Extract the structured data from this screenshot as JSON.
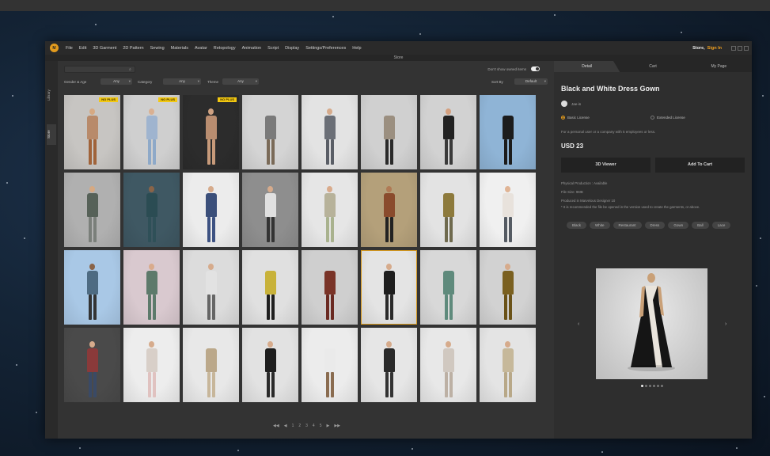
{
  "menu": {
    "logo": "M",
    "items": [
      "File",
      "Edit",
      "3D Garment",
      "2D Pattern",
      "Sewing",
      "Materials",
      "Avatar",
      "Retopology",
      "Animation",
      "Script",
      "Display",
      "Settings/Preferences",
      "Help"
    ],
    "store": "Store,",
    "sign_in": "Sign In"
  },
  "window_title": "Store",
  "rail": {
    "tab1": "Library",
    "tab2": "Store"
  },
  "catalog": {
    "toggle_label": "Don't show owned items",
    "filters": {
      "gender_label": "Gender & Age",
      "gender_value": "Any",
      "category_label": "Category",
      "category_value": "Any",
      "theme_label": "Theme",
      "theme_value": "Any",
      "sort_label": "Sort By",
      "sort_value": "Default"
    },
    "badge_text": "NO PLUS",
    "pager": [
      "◀◀",
      "◀",
      "1",
      "2",
      "3",
      "4",
      "5",
      "▶",
      "▶▶"
    ]
  },
  "tiles": [
    {
      "bg": "#c7c5c2",
      "skin": "#d6a982",
      "top": "#b88a6a",
      "bottom": "#a0633a",
      "badge": true
    },
    {
      "bg": "#cfcfcf",
      "skin": "#d9b092",
      "top": "#9fb4cf",
      "bottom": "#8ea9c8",
      "badge": true
    },
    {
      "bg": "#2c2c2c",
      "skin": "#cfa282",
      "top": "#b98d70",
      "bottom": "#c79a7a",
      "badge": true
    },
    {
      "bg": "#d4d4d4",
      "skin": "#d4d4d4",
      "top": "#7a7a7a",
      "bottom": "#7a6a58",
      "badge": false
    },
    {
      "bg": "#e3e3e3",
      "skin": "#d6ab8c",
      "top": "#6b6f77",
      "bottom": "#5a5e66",
      "badge": false
    },
    {
      "bg": "#d0d0d0",
      "skin": "#d0d0d0",
      "top": "#9b8f80",
      "bottom": "#2a2a2a",
      "badge": false
    },
    {
      "bg": "#d2d2d2",
      "skin": "#d4a07f",
      "top": "#222222",
      "bottom": "#3a3a3a",
      "badge": false
    },
    {
      "bg": "#8fb4d6",
      "skin": "#8fb4d6",
      "top": "#1c1c1c",
      "bottom": "#1c1c1c",
      "badge": false
    },
    {
      "bg": "#b0b0b0",
      "skin": "#d6a982",
      "top": "#566158",
      "bottom": "#7a7f7a",
      "badge": false
    },
    {
      "bg": "#3f5863",
      "skin": "#8a6448",
      "top": "#2b4c53",
      "bottom": "#2f5058",
      "badge": false
    },
    {
      "bg": "#ececec",
      "skin": "#d6ab8c",
      "top": "#3b4f7a",
      "bottom": "#3d5282",
      "badge": false
    },
    {
      "bg": "#8e8e8e",
      "skin": "#d6ab8c",
      "top": "#e0e0e0",
      "bottom": "#333333",
      "badge": false
    },
    {
      "bg": "#e6e6e6",
      "skin": "#d9ab8c",
      "top": "#b7b29a",
      "bottom": "#a9b28e",
      "badge": false
    },
    {
      "bg": "#b4a07a",
      "skin": "#b07a55",
      "top": "#8a4b2c",
      "bottom": "#222222",
      "badge": false
    },
    {
      "bg": "#e3e3e3",
      "skin": "#e3e3e3",
      "top": "#8d7a3c",
      "bottom": "#6f6a4e",
      "badge": false
    },
    {
      "bg": "#f0f0f0",
      "skin": "#e0b495",
      "top": "#e8e2dc",
      "bottom": "#555b63",
      "badge": false
    },
    {
      "bg": "#a9c8e6",
      "skin": "#8a6448",
      "top": "#4e6b82",
      "bottom": "#333333",
      "badge": false
    },
    {
      "bg": "#d9c9cf",
      "skin": "#d9ab8c",
      "top": "#5d7a6b",
      "bottom": "#5d7a6b",
      "badge": false
    },
    {
      "bg": "#dcdcdc",
      "skin": "#d6ab8c",
      "top": "#e2e2e2",
      "bottom": "#666666",
      "badge": false
    },
    {
      "bg": "#e0e0e0",
      "skin": "#e0e0e0",
      "top": "#c8b23a",
      "bottom": "#1f1f1f",
      "badge": false
    },
    {
      "bg": "#cfcfcf",
      "skin": "#cfcfcf",
      "top": "#7a3428",
      "bottom": "#6a2a22",
      "badge": false
    },
    {
      "bg": "#e4e4e4",
      "skin": "#d6ab8c",
      "top": "#1e1e1e",
      "bottom": "#2a2a2a",
      "badge": false,
      "selected": true
    },
    {
      "bg": "#d8d8d8",
      "skin": "#d8d8d8",
      "top": "#5f8a7c",
      "bottom": "#5f8a7c",
      "badge": false
    },
    {
      "bg": "#d2d2d2",
      "skin": "#d6ab8c",
      "top": "#7a6020",
      "bottom": "#6a5218",
      "badge": false
    },
    {
      "bg": "#4a4a4a",
      "skin": "#d6ab8c",
      "top": "#8a3a3a",
      "bottom": "#3a4a66",
      "badge": false
    },
    {
      "bg": "#ededed",
      "skin": "#d6ab8c",
      "top": "#d8cfc8",
      "bottom": "#e0c2c0",
      "badge": false
    },
    {
      "bg": "#e8e8e8",
      "skin": "#e8e8e8",
      "top": "#bba88a",
      "bottom": "#c7b69a",
      "badge": false
    },
    {
      "bg": "#e2e2e2",
      "skin": "#d6ab8c",
      "top": "#1e1e1e",
      "bottom": "#2a2a2a",
      "badge": false
    },
    {
      "bg": "#ececec",
      "skin": "#ececec",
      "top": "#eaeaea",
      "bottom": "#8a6c50",
      "badge": false
    },
    {
      "bg": "#e6e6e6",
      "skin": "#d6ab8c",
      "top": "#2a2a2a",
      "bottom": "#333333",
      "badge": false
    },
    {
      "bg": "#e8e8e8",
      "skin": "#d6ab8c",
      "top": "#d0c8c0",
      "bottom": "#bcb0a4",
      "badge": false
    },
    {
      "bg": "#e4e4e4",
      "skin": "#d6ab8c",
      "top": "#c6b89a",
      "bottom": "#b8a888",
      "badge": false
    }
  ],
  "detail": {
    "tabs": [
      "Detail",
      "Cart",
      "My Page"
    ],
    "title": "Black and White Dress Gown",
    "author": "Jae-in",
    "license_basic": "Basic License",
    "license_extended": "Extended License",
    "license_desc": "For a personal user or a company with 5 employees or less.",
    "price": "USD 23",
    "viewer_button": "3D Viewer",
    "cart_button": "Add To Cart",
    "info": [
      "Physical Production : Available",
      "File Size: 9MB",
      "Produced in Marvelous Designer 10",
      "* It is recommended the file be opened in the version used to create the garments, or above."
    ],
    "tags": [
      "Black",
      "White",
      "Restaurant",
      "Dress",
      "Gown",
      "Ball",
      "Lace"
    ],
    "prev_arrow": "‹",
    "next_arrow": "›"
  }
}
